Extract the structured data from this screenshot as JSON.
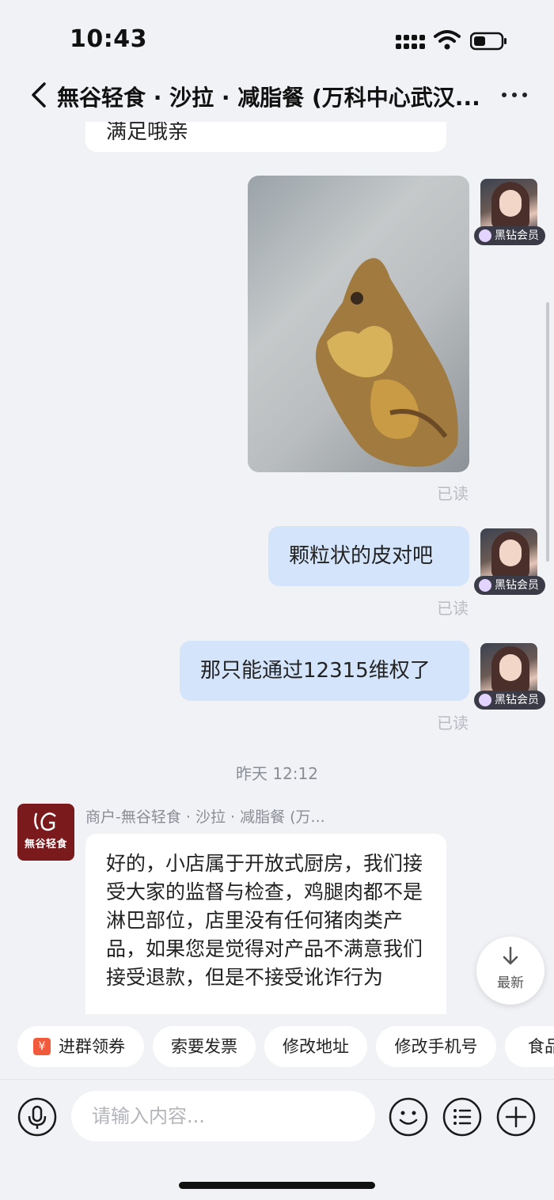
{
  "status_bar": {
    "time": "10:43"
  },
  "nav": {
    "title": "無谷轻食 · 沙拉 · 减脂餐 (万科中心武汉..."
  },
  "messages": {
    "cut_off_text": "满足哦亲",
    "vip_badge": "黑钻会员",
    "read_label": "已读",
    "sent_1": "颗粒状的皮对吧",
    "sent_2": "那只能通过12315维权了",
    "timestamp": "昨天 12:12",
    "merchant_name": "商户-無谷轻食 · 沙拉 · 减脂餐 (万...",
    "merchant_logo_text": "無谷轻食",
    "received_1": "好的，小店属于开放式厨房，我们接受大家的监督与检查，鸡腿肉都不是淋巴部位，店里没有任何猪肉类产品，如果您是觉得对产品不满意我们接受退款，但是不接受讹诈行为"
  },
  "latest_button": {
    "label": "最新"
  },
  "quick_actions": [
    {
      "label": "进群领券",
      "icon": "coupon-icon"
    },
    {
      "label": "索要发票"
    },
    {
      "label": "修改地址"
    },
    {
      "label": "修改手机号"
    },
    {
      "label": "食品"
    }
  ],
  "input": {
    "placeholder": "请输入内容..."
  },
  "colors": {
    "sent_bubble": "#d3e4fb",
    "vip_badge": "#3b3b47",
    "brand": "#7a1a1c",
    "background": "#f1f2f6"
  }
}
